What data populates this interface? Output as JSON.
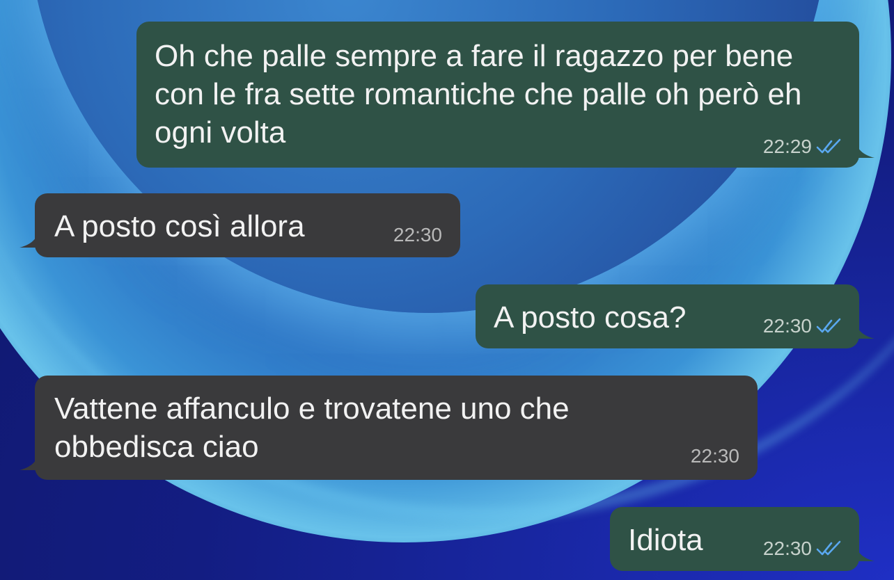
{
  "colors": {
    "outgoing_bubble": "#2f5246",
    "incoming_bubble": "#3a3a3c",
    "read_ticks": "#5aa8f0",
    "text": "#f2f2f2"
  },
  "messages": [
    {
      "direction": "outgoing",
      "text": "Oh che palle sempre a fare il ragazzo per bene con le fra sette romantiche che palle oh però eh ogni volta",
      "time": "22:29",
      "status_icon": "double-check-read-icon"
    },
    {
      "direction": "incoming",
      "text": "A posto così allora",
      "time": "22:30"
    },
    {
      "direction": "outgoing",
      "text": "A posto cosa?",
      "time": "22:30",
      "status_icon": "double-check-read-icon"
    },
    {
      "direction": "incoming",
      "text": "Vattene affanculo e trovatene uno che obbedisca ciao",
      "time": "22:30"
    },
    {
      "direction": "outgoing",
      "text": "Idiota",
      "time": "22:30",
      "status_icon": "double-check-read-icon"
    }
  ]
}
